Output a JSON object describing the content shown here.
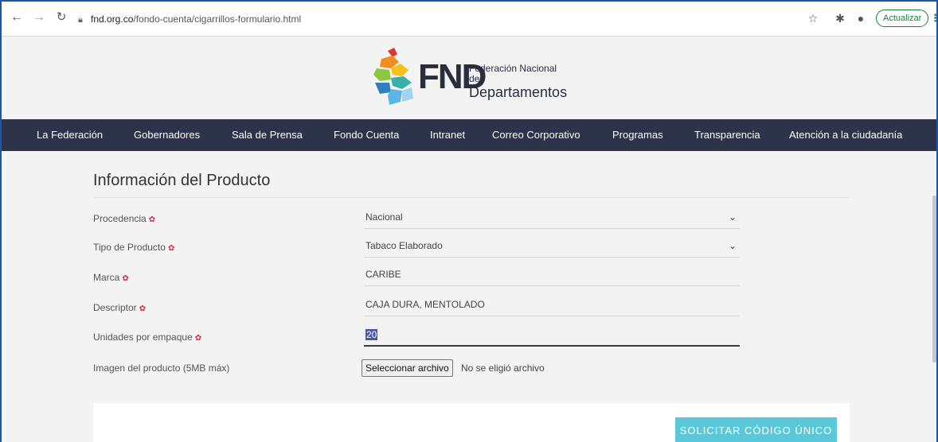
{
  "browser": {
    "url_domain": "fnd.org.co",
    "url_path": "/fondo-cuenta/cigarrillos-formulario.html",
    "update_label": "Actualizar"
  },
  "logo": {
    "abbr": "FND",
    "line1": "Federación Nacional de",
    "line2": "Departamentos"
  },
  "nav": {
    "items": [
      "La Federación",
      "Gobernadores",
      "Sala de Prensa",
      "Fondo Cuenta",
      "Intranet",
      "Correo Corporativo",
      "Programas",
      "Transparencia",
      "Atención a la ciudadanía"
    ]
  },
  "form": {
    "section_title": "Información del Producto",
    "required_mark": "✿",
    "fields": {
      "procedencia": {
        "label": "Procedencia",
        "value": "Nacional"
      },
      "tipo": {
        "label": "Tipo de Producto",
        "value": "Tabaco Elaborado"
      },
      "marca": {
        "label": "Marca",
        "value": "CARIBE"
      },
      "descriptor": {
        "label": "Descriptor",
        "value": "CAJA DURA, MENTOLADO"
      },
      "unidades": {
        "label": "Unidades por empaque",
        "value": "20"
      },
      "imagen": {
        "label": "Imagen del producto (5MB máx)",
        "button": "Seleccionar archivo",
        "status": "No se eligió archivo"
      }
    },
    "submit_label": "SOLICITAR CÓDIGO ÚNICO"
  },
  "colors": {
    "nav_bg": "#2d3349",
    "accent": "#5bc8d9",
    "required": "#d9263a"
  }
}
